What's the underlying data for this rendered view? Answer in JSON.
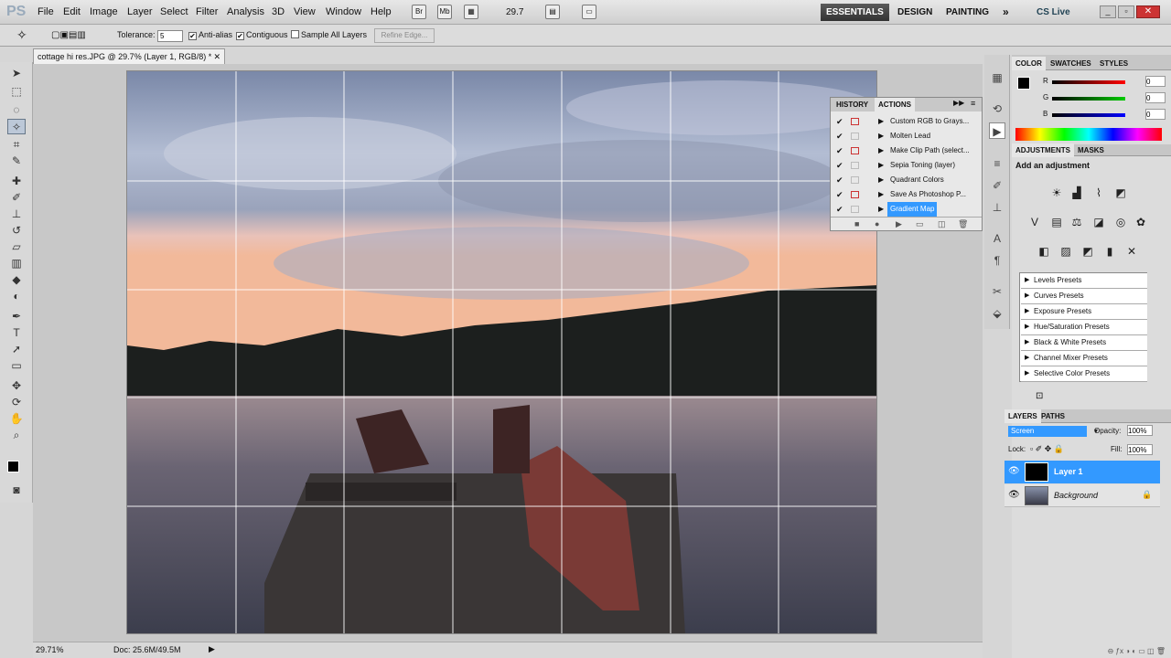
{
  "menubar": {
    "logo": "PS",
    "items": [
      "File",
      "Edit",
      "Image",
      "Layer",
      "Select",
      "Filter",
      "Analysis",
      "3D",
      "View",
      "Window",
      "Help"
    ],
    "zoom": "29.7",
    "workspaces": [
      "ESSENTIALS",
      "DESIGN",
      "PAINTING"
    ],
    "cs_live": "CS Live"
  },
  "options": {
    "tolerance_label": "Tolerance:",
    "tolerance_value": "5",
    "anti_alias": "Anti-alias",
    "contiguous": "Contiguous",
    "sample_all": "Sample All Layers",
    "refine_edge": "Refine Edge..."
  },
  "document": {
    "tab_title": "cottage hi res.JPG @ 29.7% (Layer 1, RGB/8) *",
    "status_zoom": "29.71%",
    "status_doc": "Doc: 25.6M/49.5M"
  },
  "actions_panel": {
    "tabs": [
      "HISTORY",
      "ACTIONS"
    ],
    "items": [
      {
        "label": "Custom RGB to Grays...",
        "checked": true,
        "dialog": true,
        "selected": false
      },
      {
        "label": "Molten Lead",
        "checked": true,
        "dialog": false,
        "selected": false
      },
      {
        "label": "Make Clip Path (select...",
        "checked": true,
        "dialog": true,
        "selected": false
      },
      {
        "label": "Sepia Toning (layer)",
        "checked": true,
        "dialog": false,
        "selected": false
      },
      {
        "label": "Quadrant Colors",
        "checked": true,
        "dialog": false,
        "selected": false
      },
      {
        "label": "Save As Photoshop P...",
        "checked": true,
        "dialog": true,
        "selected": false
      },
      {
        "label": "Gradient Map",
        "checked": true,
        "dialog": false,
        "selected": true
      }
    ]
  },
  "color_panel": {
    "tabs": [
      "COLOR",
      "SWATCHES",
      "STYLES"
    ],
    "r_label": "R",
    "g_label": "G",
    "b_label": "B",
    "r": "0",
    "g": "0",
    "b": "0"
  },
  "adjustments_panel": {
    "tabs": [
      "ADJUSTMENTS",
      "MASKS"
    ],
    "heading": "Add an adjustment",
    "presets": [
      "Levels Presets",
      "Curves Presets",
      "Exposure Presets",
      "Hue/Saturation Presets",
      "Black & White Presets",
      "Channel Mixer Presets",
      "Selective Color Presets"
    ]
  },
  "layers_panel": {
    "tabs": [
      "LAYERS",
      "PATHS"
    ],
    "blend_mode": "Screen",
    "opacity_label": "Opacity:",
    "opacity": "100%",
    "lock_label": "Lock:",
    "fill_label": "Fill:",
    "fill": "100%",
    "layers": [
      {
        "name": "Layer 1",
        "selected": true
      },
      {
        "name": "Background",
        "selected": false
      }
    ]
  },
  "colors": {
    "accent": "#3399ff",
    "selected_bg": "#3a8ee6"
  }
}
